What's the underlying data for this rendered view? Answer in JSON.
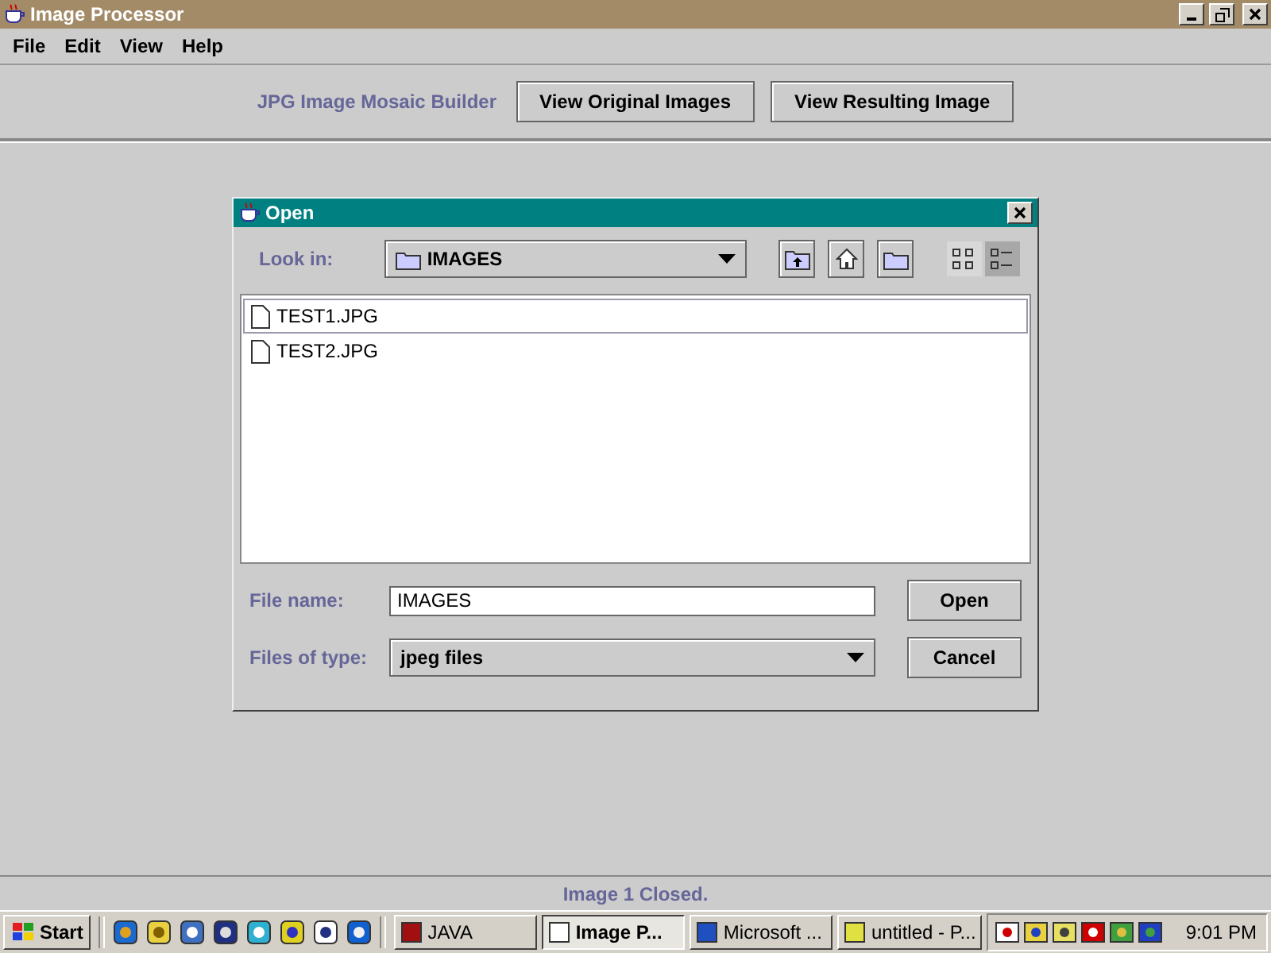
{
  "window": {
    "title": "Image Processor"
  },
  "menu": [
    "File",
    "Edit",
    "View",
    "Help"
  ],
  "toolbar": {
    "label": "JPG Image Mosaic Builder",
    "buttons": [
      "View Original Images",
      "View Resulting Image"
    ]
  },
  "dialog": {
    "title": "Open",
    "look_in": {
      "label": "Look in:",
      "value": "IMAGES"
    },
    "view_modes": [
      {
        "kind": "list",
        "selected": false
      },
      {
        "kind": "details",
        "selected": true
      }
    ],
    "files": [
      {
        "name": "TEST1.JPG",
        "selected": true
      },
      {
        "name": "TEST2.JPG",
        "selected": false
      }
    ],
    "file_name": {
      "label": "File name:",
      "value": "IMAGES"
    },
    "file_type": {
      "label": "Files of type:",
      "value": "jpeg files"
    },
    "buttons": [
      "Open",
      "Cancel"
    ]
  },
  "status_bar": "Image 1 Closed.",
  "taskbar": {
    "start": "Start",
    "tasks": [
      {
        "label": "JAVA",
        "selected": false
      },
      {
        "label": "Image P...",
        "selected": true
      },
      {
        "label": "Microsoft ...",
        "selected": false
      },
      {
        "label": "untitled - P...",
        "selected": false
      }
    ],
    "clock": "9:01 PM"
  }
}
